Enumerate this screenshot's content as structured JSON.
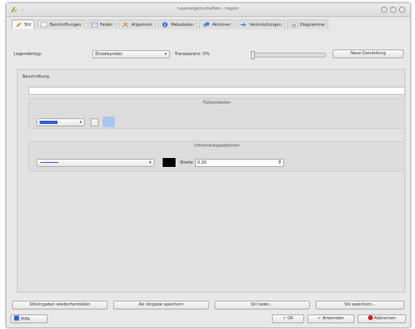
{
  "window": {
    "title": "Layereigenschaften - region",
    "separator": "—"
  },
  "tabs": [
    {
      "label": "Stil"
    },
    {
      "label": "Beschriftungen"
    },
    {
      "label": "Felder"
    },
    {
      "label": "Allgemein"
    },
    {
      "label": "Metadaten"
    },
    {
      "label": "Aktionen"
    },
    {
      "label": "Verknüpfungen"
    },
    {
      "label": "Diagramme"
    }
  ],
  "style_row": {
    "legend_type_label": "Legendentyp",
    "legend_type_value": "Einzelsymbol",
    "transparency_label": "Transparenz: 0%",
    "transparency_percent": 0,
    "new_style_button": "Neue Darstellung"
  },
  "panel": {
    "caption_label": "Beschriftung",
    "caption_value": "",
    "fill_group_title": "Füllsymbolen",
    "fill_color": "#2f5fd8",
    "fill_pattern_color": "#a8c4f0",
    "outline_group_title": "Umrandungsoptionen",
    "outline_line_color": "#3a55c8",
    "outline_color": "#000000",
    "width_label": "Breite",
    "width_value": "0,26"
  },
  "bottom_buttons": {
    "restore": "Stilvorgaben wiederherstellen",
    "save_default": "Als Vorgabe speichern",
    "load_style": "Stil laden...",
    "save_style": "Stil speichern..."
  },
  "footer": {
    "help": "Hilfe",
    "ok": "OK",
    "apply": "Anwenden",
    "cancel": "Abbrechen"
  },
  "icons": {
    "logo": "qgis-logo-icon",
    "ok": "check-icon",
    "apply": "check-icon",
    "cancel": "cancel-icon",
    "help": "help-icon"
  }
}
